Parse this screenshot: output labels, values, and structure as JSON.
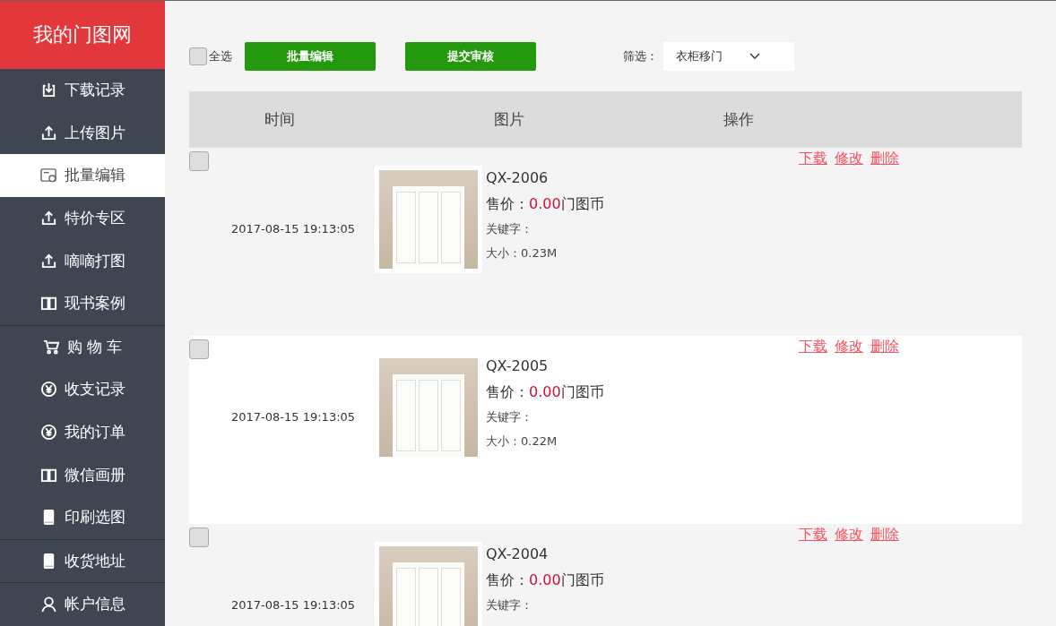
{
  "logo": "我的门图网",
  "sidebar": {
    "sections": [
      {
        "items": [
          {
            "label": "下载记录",
            "selected": false
          },
          {
            "label": "上传图片",
            "selected": false
          },
          {
            "label": "批量编辑",
            "selected": true
          },
          {
            "label": "特价专区",
            "selected": false
          },
          {
            "label": "嘀嘀打图",
            "selected": false
          },
          {
            "label": "现书案例",
            "selected": false
          }
        ]
      },
      {
        "items": [
          {
            "label": "购 物 车",
            "selected": false
          },
          {
            "label": "收支记录",
            "selected": false
          },
          {
            "label": "我的订单",
            "selected": false
          },
          {
            "label": "微信画册",
            "selected": false
          },
          {
            "label": "印刷选图",
            "selected": false
          }
        ]
      },
      {
        "items": [
          {
            "label": "收货地址",
            "selected": false
          }
        ]
      },
      {
        "items": [
          {
            "label": "帐户信息",
            "selected": false
          }
        ]
      }
    ]
  },
  "toolbar": {
    "select_all": {
      "label": "全选",
      "checked": false
    },
    "buttons": [
      "批量编辑",
      "提交审核"
    ],
    "filter": {
      "label": "筛选：",
      "value": "衣柜移门"
    }
  },
  "table": {
    "columns": [
      "时间",
      "图片",
      "操作"
    ],
    "rows": [
      {
        "checked": false,
        "time": "2017-08-15 19:13:05",
        "code": "QX-2006",
        "price_label": "售价：",
        "price": "0.00",
        "price_unit": "门图币",
        "keywords": "关键字：",
        "size": "大小：0.23M",
        "actions": [
          "下载",
          "修改",
          "删除"
        ]
      },
      {
        "checked": false,
        "time": "2017-08-15 19:13:05",
        "code": "QX-2005",
        "price_label": "售价：",
        "price": "0.00",
        "price_unit": "门图币",
        "keywords": "关键字：",
        "size": "大小：0.22M",
        "actions": [
          "下载",
          "修改",
          "删除"
        ]
      },
      {
        "checked": false,
        "time": "2017-08-15 19:13:05",
        "code": "QX-2004",
        "price_label": "售价：",
        "price": "0.00",
        "price_unit": "门图币",
        "keywords": "关键字：",
        "actions": [
          "下载",
          "修改",
          "删除"
        ]
      }
    ]
  }
}
